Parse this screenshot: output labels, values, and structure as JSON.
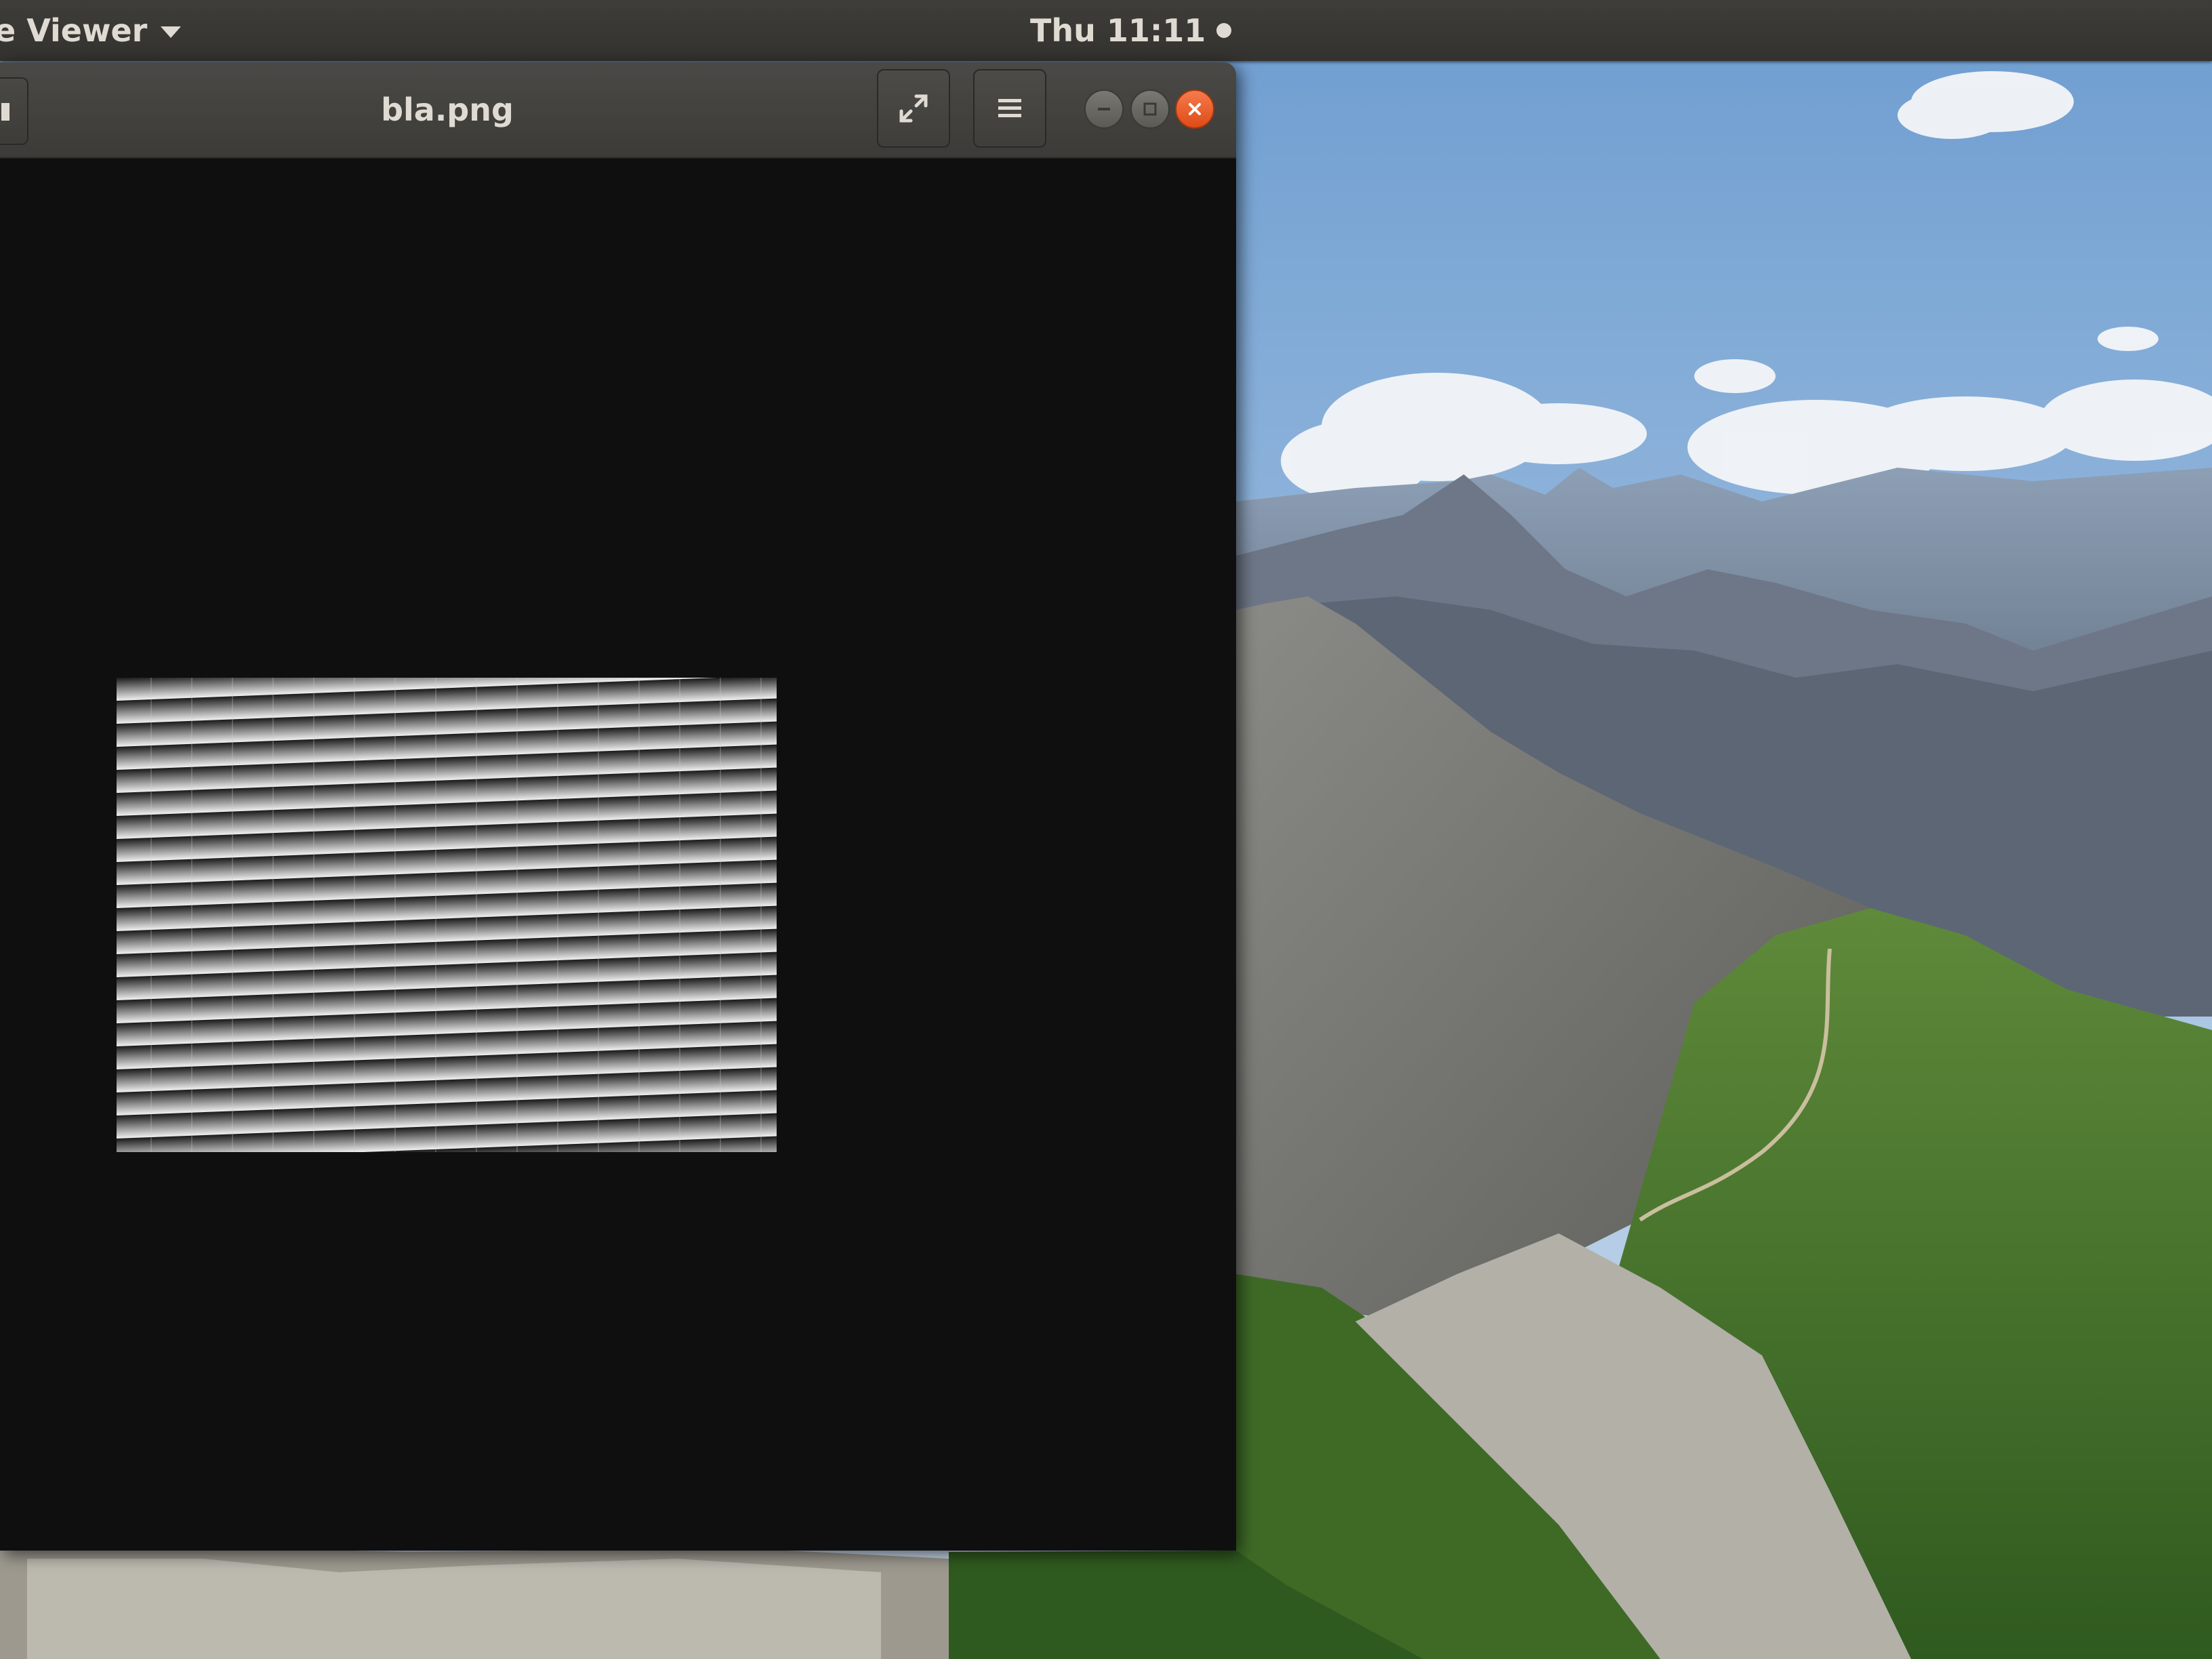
{
  "top_panel": {
    "app_menu_label": "e Viewer",
    "clock": "Thu 11:11"
  },
  "viewer": {
    "title": "bla.png",
    "buttons": {
      "fullscreen_icon": "fullscreen-icon",
      "menu_icon": "hamburger-menu-icon",
      "minimize_icon": "minimize-icon",
      "maximize_icon": "maximize-icon",
      "close_icon": "close-icon"
    },
    "image_pattern": "sawtooth-gradient-stripes"
  },
  "colors": {
    "panel_bg": "#3a3935",
    "panel_text": "#dfdbd2",
    "close_accent": "#e95420",
    "canvas_bg": "#0f0f10",
    "sky": "#8fb3d8"
  }
}
